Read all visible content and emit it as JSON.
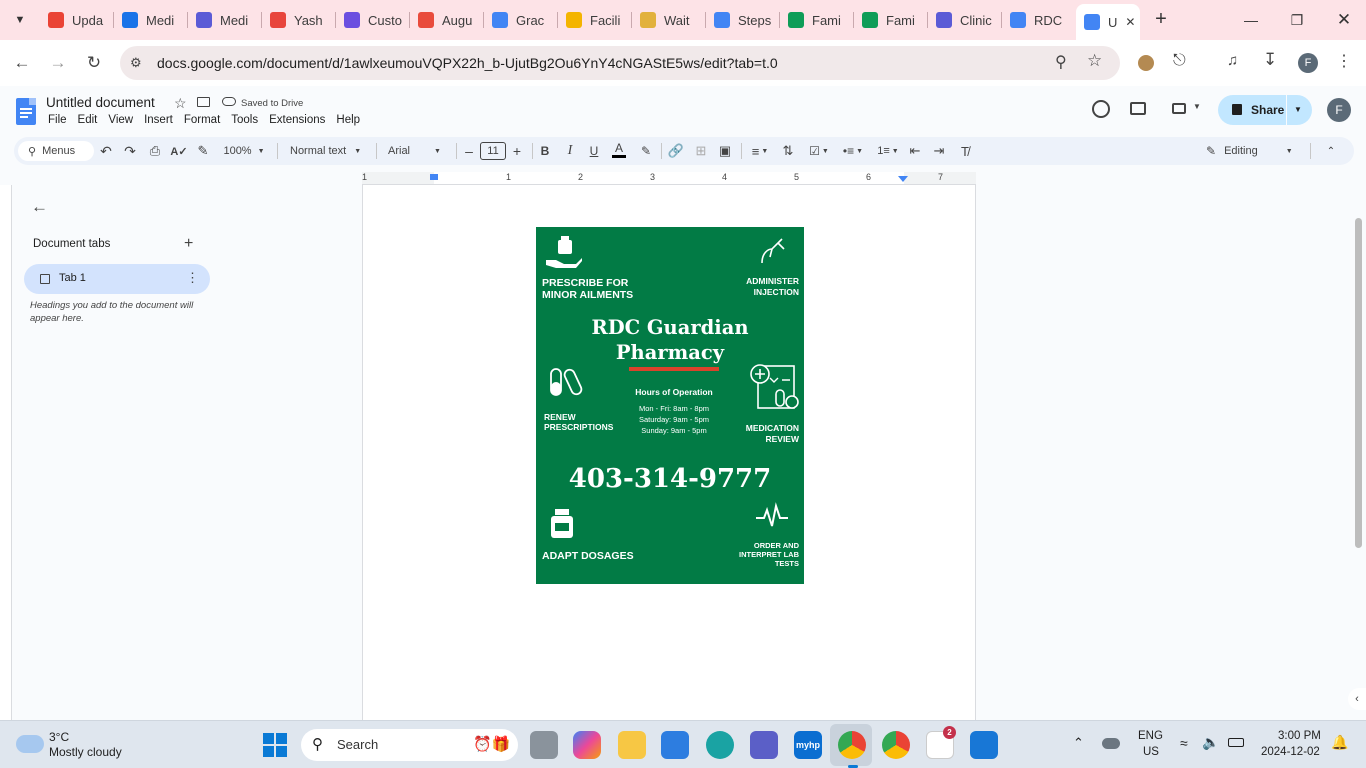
{
  "browser": {
    "tabs": [
      {
        "label": "Upda",
        "icon": "gmail-icon",
        "color": "#ea4335"
      },
      {
        "label": "Medi",
        "icon": "calendar-icon",
        "color": "#1a73e8"
      },
      {
        "label": "Medi",
        "icon": "meet-m-icon",
        "color": "#5b5bd6"
      },
      {
        "label": "Yash",
        "icon": "shapes-icon",
        "color": "#e8453c"
      },
      {
        "label": "Custo",
        "icon": "s-app-icon",
        "color": "#6b4fe0"
      },
      {
        "label": "Augu",
        "icon": "dots-icon",
        "color": "#e94b3c"
      },
      {
        "label": "Grac",
        "icon": "docs-icon",
        "color": "#4285f4"
      },
      {
        "label": "Facili",
        "icon": "bar-chart-icon",
        "color": "#f4b400"
      },
      {
        "label": "Wait",
        "icon": "note-icon",
        "color": "#e2b13c"
      },
      {
        "label": "Steps",
        "icon": "docs-icon",
        "color": "#4285f4"
      },
      {
        "label": "Fami",
        "icon": "sheets-icon",
        "color": "#0f9d58"
      },
      {
        "label": "Fami",
        "icon": "sheets-icon",
        "color": "#0f9d58"
      },
      {
        "label": "Clinic",
        "icon": "meet-m-icon",
        "color": "#5b5bd6"
      },
      {
        "label": "RDC",
        "icon": "google-icon",
        "color": "#4285f4"
      },
      {
        "label": "U",
        "icon": "docs-icon",
        "color": "#4285f4"
      }
    ],
    "url": "docs.google.com/document/d/1awlxeumouVQPX22h_b-UjutBg2Ou6YnY4cNGAStE5ws/edit?tab=t.0",
    "profile_initial": "F"
  },
  "doc": {
    "title": "Untitled document",
    "saved_status": "Saved to Drive",
    "menus": [
      "File",
      "Edit",
      "View",
      "Insert",
      "Format",
      "Tools",
      "Extensions",
      "Help"
    ],
    "share_label": "Share",
    "avatar_initial": "F"
  },
  "format_bar": {
    "menus_label": "Menus",
    "zoom": "100%",
    "style": "Normal text",
    "font": "Arial",
    "font_size": "11",
    "mode": "Editing"
  },
  "ruler_numbers": [
    "1",
    "1",
    "2",
    "3",
    "4",
    "5",
    "6",
    "7"
  ],
  "sidebar": {
    "header": "Document tabs",
    "tab_label": "Tab 1",
    "hint": "Headings you add to the document will appear here."
  },
  "poster": {
    "bg_color": "#027b45",
    "accent_color": "#d9432b",
    "top_left": "PRESCRIBE FOR MINOR AILMENTS",
    "top_right_1": "ADMINISTER",
    "top_right_2": "INJECTION",
    "name_1": "RDC Guardian",
    "name_2": "Pharmacy",
    "hours_title": "Hours of Operation",
    "hours_1": "Mon - Fri: 8am - 8pm",
    "hours_2": "Saturday: 9am - 5pm",
    "hours_3": "Sunday: 9am - 5pm",
    "renew_1": "RENEW",
    "renew_2": "PRESCRIPTIONS",
    "review_1": "MEDICATION",
    "review_2": "REVIEW",
    "phone": "403-314-9777",
    "adapt": "ADAPT DOSAGES",
    "lab_1": "ORDER AND",
    "lab_2": "INTERPRET LAB",
    "lab_3": "TESTS"
  },
  "taskbar": {
    "weather_temp": "3°C",
    "weather_desc": "Mostly cloudy",
    "search_label": "Search",
    "lang_1": "ENG",
    "lang_2": "US",
    "time": "3:00 PM",
    "date": "2024-12-02",
    "slack_badge": "2"
  }
}
